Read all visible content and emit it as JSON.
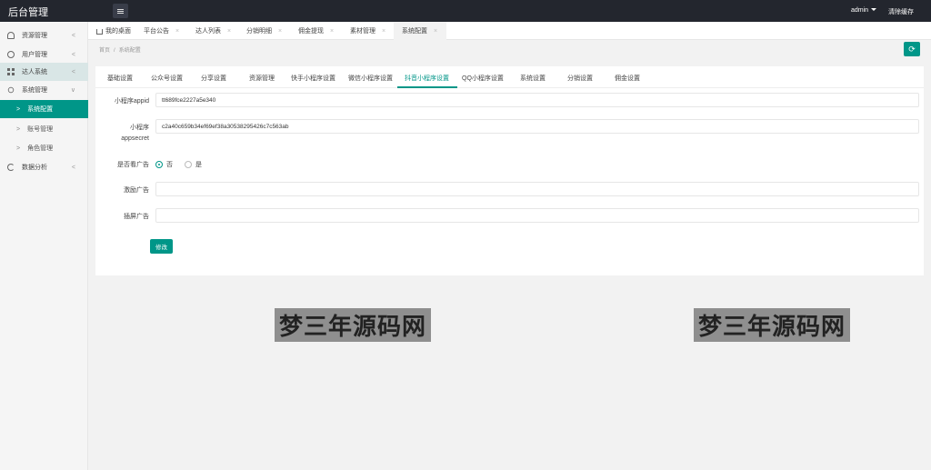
{
  "header": {
    "brand": "后台管理",
    "user": "admin",
    "clear_cache": "清除缓存"
  },
  "sidebar": {
    "items": [
      {
        "label": "资源管理",
        "icon": "user-outline-icon",
        "arrow": "<"
      },
      {
        "label": "用户管理",
        "icon": "face-icon",
        "arrow": "<"
      },
      {
        "label": "达人系统",
        "icon": "grid-icon",
        "arrow": "<"
      },
      {
        "label": "系统管理",
        "icon": "person-icon",
        "arrow": "∨"
      }
    ],
    "sub_items": [
      {
        "label": "系统配置"
      },
      {
        "label": "账号管理"
      },
      {
        "label": "角色管理"
      }
    ],
    "last_item": {
      "label": "数据分析",
      "icon": "chart-icon",
      "arrow": "<"
    }
  },
  "page_tabs": [
    {
      "label": "我的桌面"
    },
    {
      "label": "平台公告"
    },
    {
      "label": "达人列表"
    },
    {
      "label": "分销明细"
    },
    {
      "label": "佣金提现"
    },
    {
      "label": "素材管理"
    },
    {
      "label": "系统配置"
    }
  ],
  "breadcrumb": {
    "home": "首页",
    "sep": "/",
    "current": "系统配置"
  },
  "settings_tabs": [
    {
      "label": "基础设置"
    },
    {
      "label": "公众号设置"
    },
    {
      "label": "分享设置"
    },
    {
      "label": "资源管理"
    },
    {
      "label": "快手小程序设置"
    },
    {
      "label": "微信小程序设置"
    },
    {
      "label": "抖音小程序设置"
    },
    {
      "label": "QQ小程序设置"
    },
    {
      "label": "系统设置"
    },
    {
      "label": "分销设置"
    },
    {
      "label": "佣金设置"
    }
  ],
  "form": {
    "appid_label": "小程序appid",
    "appid_value": "tt689fce2227a5e340",
    "secret_label_1": "小程序",
    "secret_label_2": "appsecret",
    "secret_value": "c2a40c659b34ef69ef38a30538295426c7c563ab",
    "ad_toggle_label": "是否看广告",
    "ad_no": "否",
    "ad_yes": "是",
    "reward_ad_label": "激励广告",
    "reward_ad_value": "",
    "insert_ad_label": "插屏广告",
    "insert_ad_value": "",
    "submit_label": "修改"
  },
  "watermark": {
    "text": "梦三年源码网"
  },
  "colors": {
    "accent": "#009688",
    "topbar": "#23262e"
  }
}
